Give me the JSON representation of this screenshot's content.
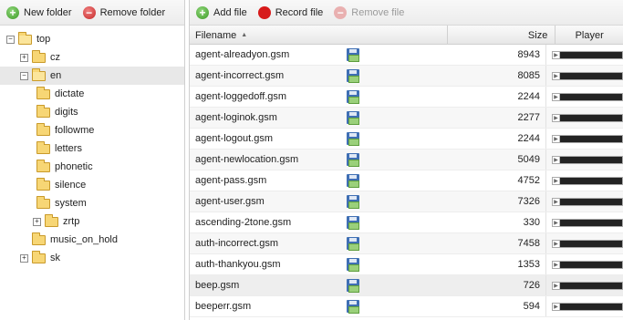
{
  "left_toolbar": {
    "new_folder": "New folder",
    "remove_folder": "Remove folder"
  },
  "tree": [
    {
      "label": "top",
      "expander": "−",
      "open": true
    },
    {
      "label": "cz",
      "expander": "+",
      "open": false
    },
    {
      "label": "en",
      "expander": "−",
      "open": true,
      "selected": true
    },
    {
      "label": "dictate",
      "expander": "",
      "open": false
    },
    {
      "label": "digits",
      "expander": "",
      "open": false
    },
    {
      "label": "followme",
      "expander": "",
      "open": false
    },
    {
      "label": "letters",
      "expander": "",
      "open": false
    },
    {
      "label": "phonetic",
      "expander": "",
      "open": false
    },
    {
      "label": "silence",
      "expander": "",
      "open": false
    },
    {
      "label": "system",
      "expander": "",
      "open": false
    },
    {
      "label": "zrtp",
      "expander": "+",
      "open": false
    },
    {
      "label": "music_on_hold",
      "expander": "",
      "open": false
    },
    {
      "label": "sk",
      "expander": "+",
      "open": false
    }
  ],
  "right_toolbar": {
    "add_file": "Add file",
    "record_file": "Record file",
    "remove_file": "Remove file"
  },
  "table": {
    "headers": {
      "filename": "Filename",
      "size": "Size",
      "player": "Player"
    },
    "rows": [
      {
        "name": "agent-alreadyon.gsm",
        "size": "8943"
      },
      {
        "name": "agent-incorrect.gsm",
        "size": "8085"
      },
      {
        "name": "agent-loggedoff.gsm",
        "size": "2244"
      },
      {
        "name": "agent-loginok.gsm",
        "size": "2277"
      },
      {
        "name": "agent-logout.gsm",
        "size": "2244"
      },
      {
        "name": "agent-newlocation.gsm",
        "size": "5049"
      },
      {
        "name": "agent-pass.gsm",
        "size": "4752"
      },
      {
        "name": "agent-user.gsm",
        "size": "7326"
      },
      {
        "name": "ascending-2tone.gsm",
        "size": "330"
      },
      {
        "name": "auth-incorrect.gsm",
        "size": "7458"
      },
      {
        "name": "auth-thankyou.gsm",
        "size": "1353"
      },
      {
        "name": "beep.gsm",
        "size": "726"
      },
      {
        "name": "beeperr.gsm",
        "size": "594"
      }
    ]
  }
}
